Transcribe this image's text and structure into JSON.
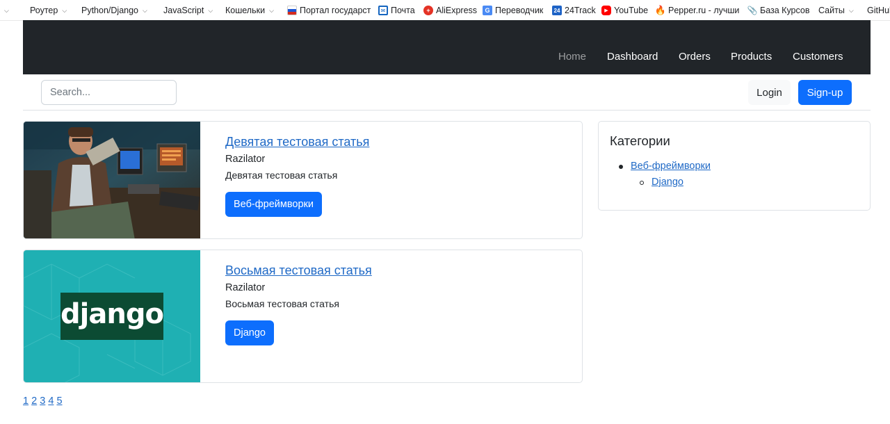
{
  "bookmarks": [
    {
      "label": "",
      "chevron": true
    },
    {
      "label": "Роутер",
      "chevron": true
    },
    {
      "label": "Python/Django",
      "chevron": true
    },
    {
      "label": "JavaScript",
      "chevron": true
    },
    {
      "label": "Кошельки",
      "chevron": true
    },
    {
      "label": "Портал государст",
      "icon": "russia-flag-icon"
    },
    {
      "label": "Почта",
      "icon": "mail-icon"
    },
    {
      "label": "AliExpress",
      "icon": "aliexpress-icon"
    },
    {
      "label": "Переводчик",
      "icon": "translate-icon"
    },
    {
      "label": "24Track",
      "icon": "24track-icon"
    },
    {
      "label": "YouTube",
      "icon": "youtube-icon"
    },
    {
      "label": "Pepper.ru - лучши",
      "icon": "flame-icon"
    },
    {
      "label": "База Курсов",
      "icon": "paperclip-icon"
    },
    {
      "label": "Сайты",
      "chevron": true
    },
    {
      "label": "GitHul"
    }
  ],
  "nav": {
    "home": "Home",
    "dashboard": "Dashboard",
    "orders": "Orders",
    "products": "Products",
    "customers": "Customers"
  },
  "search": {
    "placeholder": "Search..."
  },
  "auth": {
    "login": "Login",
    "signup": "Sign-up"
  },
  "articles": [
    {
      "title": "Девятая тестовая статья",
      "author": "Razilator",
      "description": "Девятая тестовая статья",
      "category": "Веб-фреймворки",
      "image": "retro-computer-photo"
    },
    {
      "title": "Восьмая тестовая статья",
      "author": "Razilator",
      "description": "Восьмая тестовая статья",
      "category": "Django",
      "image_logo_text": "django"
    }
  ],
  "sidebar": {
    "title": "Категории",
    "categories": [
      {
        "label": "Веб-фреймворки",
        "children": [
          {
            "label": "Django"
          }
        ]
      }
    ]
  },
  "pagination": {
    "pages": [
      "1",
      "2",
      "3",
      "4",
      "5"
    ]
  },
  "colors": {
    "navbar_bg": "#212529",
    "primary": "#0d6efd",
    "link": "#1f69c6",
    "django_teal": "#1fb0b3",
    "django_dark": "#0c4b33"
  }
}
